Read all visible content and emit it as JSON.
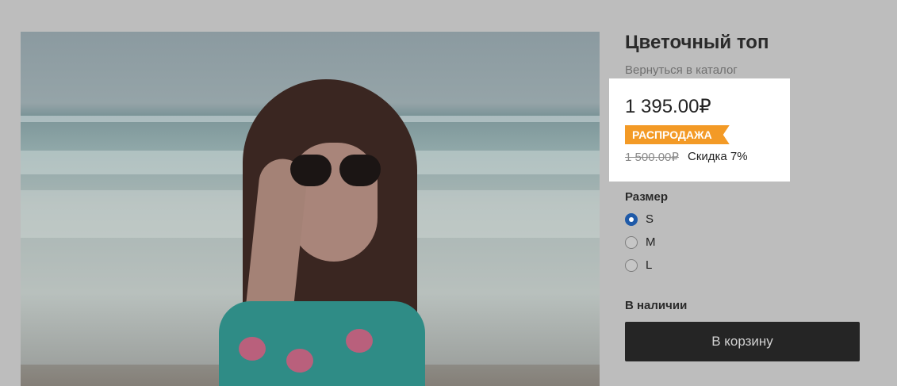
{
  "product": {
    "title": "Цветочный топ",
    "back_link": "Вернуться в каталог",
    "image_description": "woman-on-beach-photo"
  },
  "pricing": {
    "price": "1 395.00₽",
    "badge": "РАСПРОДАЖА",
    "old_price": "1 500.00₽",
    "discount": "Скидка 7%"
  },
  "size": {
    "label": "Размер",
    "options": [
      "S",
      "M",
      "L"
    ],
    "selected": "S"
  },
  "stock": "В наличии",
  "cart_button": "В корзину",
  "colors": {
    "badge": "#f39a26",
    "button": "#252525",
    "radio_checked": "#1f5aa8"
  }
}
